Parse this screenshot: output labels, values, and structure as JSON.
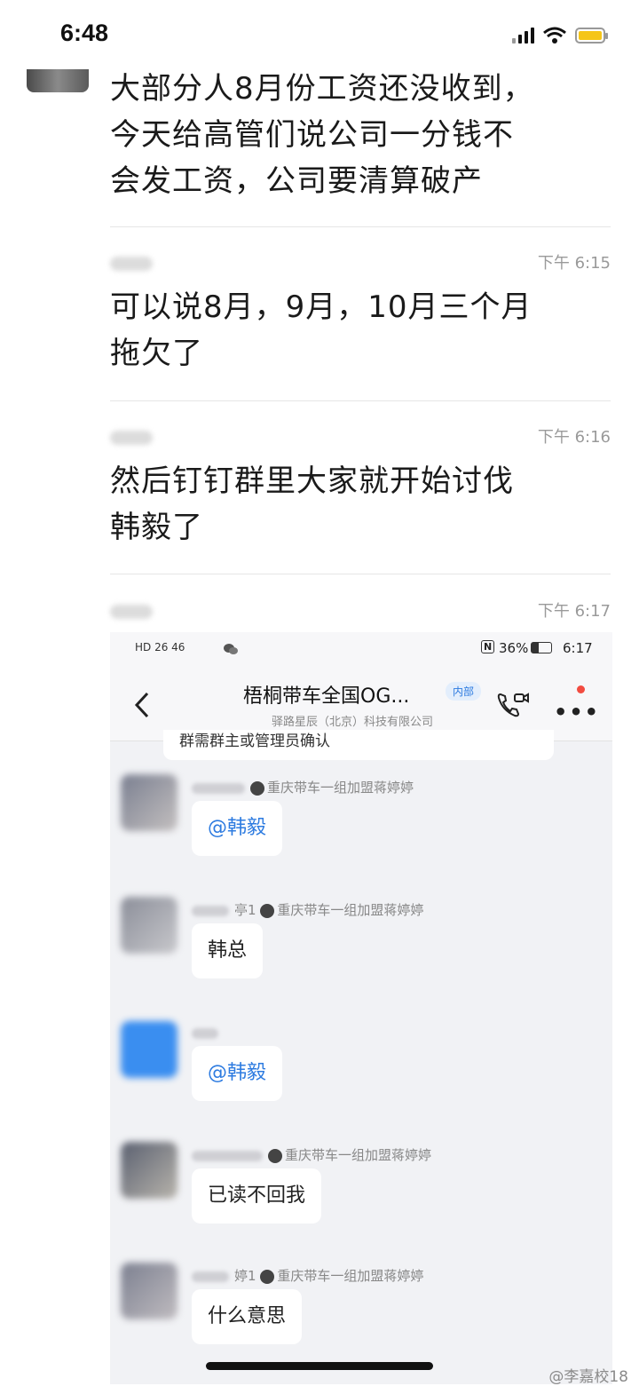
{
  "status_bar": {
    "time": "6:48"
  },
  "messages": [
    {
      "text_lines": [
        "大部分人8月份工资还没收到，",
        "今天给高管们说公司一分钱不",
        "会发工资，公司要清算破产"
      ]
    },
    {
      "time": "下午 6:15",
      "text_lines": [
        "可以说8月，9月，10月三个月",
        "拖欠了"
      ]
    },
    {
      "time": "下午 6:16",
      "text_lines": [
        "然后钉钉群里大家就开始讨伐",
        "韩毅了"
      ]
    },
    {
      "time": "下午 6:17"
    }
  ],
  "embedded": {
    "status": {
      "network": "HD 26 46",
      "nfc": "N",
      "battery": "36%",
      "time": "6:17"
    },
    "header": {
      "title": "梧桐带车全国OG...",
      "badge": "内部",
      "subtitle": "驿路星辰（北京）科技有限公司"
    },
    "notice": "群需群主或管理员确认",
    "chat": [
      {
        "sender_suffix": "",
        "sender": "重庆带车一组加盟蒋婷婷",
        "text": "@韩毅",
        "mention": true
      },
      {
        "sender_suffix": "亭1",
        "sender": "重庆带车一组加盟蒋婷婷",
        "text": "韩总",
        "mention": false
      },
      {
        "sender_suffix": "",
        "sender": "",
        "text": "@韩毅",
        "mention": true
      },
      {
        "sender_suffix": "",
        "sender": "重庆带车一组加盟蒋婷婷",
        "text": "已读不回我",
        "mention": false
      },
      {
        "sender_suffix": "婷1",
        "sender": "重庆带车一组加盟蒋婷婷",
        "text": "什么意思",
        "mention": false
      }
    ]
  },
  "watermark": "@李嘉校18"
}
